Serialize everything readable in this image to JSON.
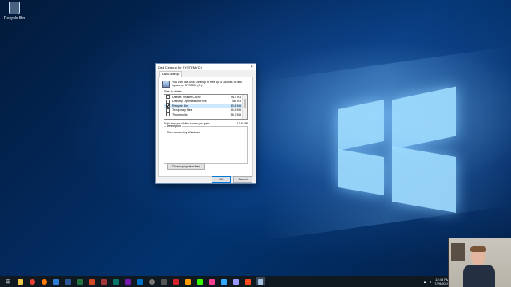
{
  "desktop": {
    "recycle_bin_label": "Recycle Bin"
  },
  "dialog": {
    "title": "Disk Cleanup for SYSTEM (C:)",
    "close_glyph": "×",
    "tab_label": "Disk Cleanup",
    "intro_text": "You can use Disk Cleanup to free up to 285 MB of disk space on SYSTEM (C:).",
    "files_label": "Files to delete:",
    "items": [
      {
        "name": "DirectX Shader Cache",
        "size": "66.5 KB",
        "checked": false
      },
      {
        "name": "Delivery Optimization Files",
        "size": "788 KB",
        "checked": false
      },
      {
        "name": "Recycle Bin",
        "size": "13.8 MB",
        "checked": true
      },
      {
        "name": "Temporary files",
        "size": "44.6 MB",
        "checked": false
      },
      {
        "name": "Thumbnails",
        "size": "58.7 MB",
        "checked": false
      }
    ],
    "total_label": "Total amount of disk space you gain:",
    "total_value": "13.8 MB",
    "description_legend": "Description",
    "description_text": "Files created by Windows",
    "cleanup_button": "Clean up system files",
    "ok_button": "OK",
    "cancel_button": "Cancel"
  },
  "taskbar": {
    "start_icon": "windows-logo-icon",
    "clock_time": "12:48 PM",
    "clock_date": "7/29/2019"
  }
}
